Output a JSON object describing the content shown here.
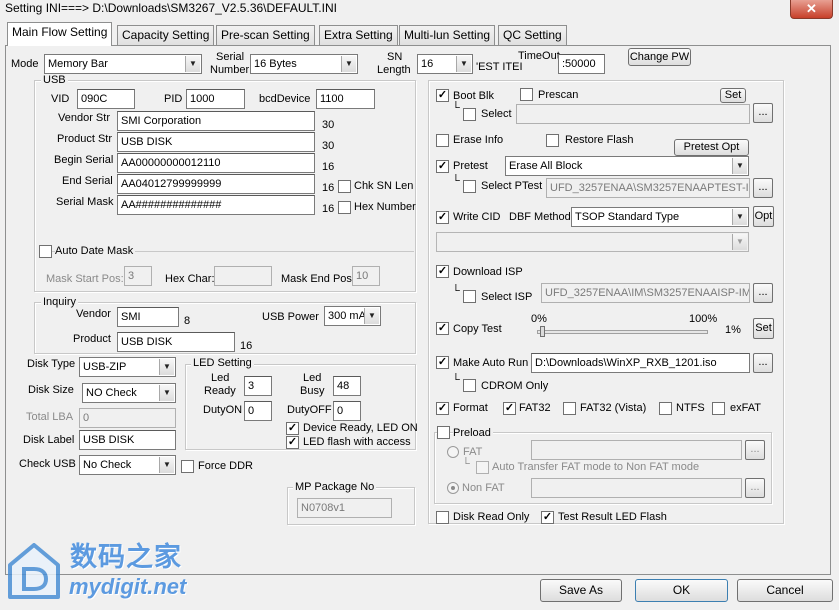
{
  "window": {
    "title": "Setting  INI===> D:\\Downloads\\SM3267_V2.5.36\\DEFAULT.INI",
    "close_icon": "close-icon"
  },
  "tabs": [
    "Main Flow Setting",
    "Capacity Setting",
    "Pre-scan Setting",
    "Extra Setting",
    "Multi-lun Setting",
    "QC Setting"
  ],
  "top": {
    "mode_label": "Mode",
    "mode_value": "Memory Bar",
    "serial_label1": "Serial",
    "serial_label2": "Number",
    "serial_value": "16 Bytes",
    "sn_label1": "SN",
    "sn_label2": "Length",
    "sn_value": "16",
    "test_item_label": "'EST ITEI",
    "timeout_label": "TimeOut",
    "timeout_value": ":50000",
    "change_pw": "Change PW"
  },
  "usb": {
    "title": "USB",
    "vid_label": "VID",
    "vid": "090C",
    "pid_label": "PID",
    "pid": "1000",
    "bcd_label": "bcdDevice",
    "bcd": "1100",
    "vendor_label": "Vendor Str",
    "vendor": "SMI Corporation",
    "vendor_len": "30",
    "product_label": "Product Str",
    "product": "USB DISK",
    "product_len": "30",
    "begin_label": "Begin Serial",
    "begin": "AA00000000012110",
    "begin_len": "16",
    "end_label": "End Serial",
    "end": "AA04012799999999",
    "end_len": "16",
    "mask_label": "Serial Mask",
    "mask": "AA##############",
    "mask_len": "16",
    "chk_sn_len": "Chk SN Len",
    "hex_number": "Hex Number",
    "auto_date_mask": "Auto Date Mask",
    "mask_start_label": "Mask Start Pos:",
    "mask_start": "3",
    "hex_char_label": "Hex Char:",
    "hex_char": "",
    "mask_end_label": "Mask End Pos:",
    "mask_end": "10"
  },
  "inquiry": {
    "title": "Inquiry",
    "vendor_label": "Vendor",
    "vendor": "SMI",
    "vendor_len": "8",
    "usb_power_label": "USB Power",
    "usb_power": "300 mA",
    "product_label": "Product",
    "product": "USB DISK",
    "product_len": "16"
  },
  "disk": {
    "type_label": "Disk Type",
    "type": "USB-ZIP",
    "size_label": "Disk Size",
    "size": "NO Check",
    "lba_label": "Total LBA",
    "lba": "0",
    "label_label": "Disk Label",
    "label": "USB DISK",
    "check_usb_label": "Check USB",
    "check_usb": "No Check",
    "force_ddr": "Force DDR"
  },
  "led": {
    "title": "LED Setting",
    "ready_label1": "Led",
    "ready_label2": "Ready",
    "ready": "3",
    "busy_label1": "Led",
    "busy_label2": "Busy",
    "busy": "48",
    "dutyon_label": "DutyON",
    "dutyon": "0",
    "dutyoff_label": "DutyOFF",
    "dutyoff": "0",
    "device_ready": "Device Ready, LED ON",
    "flash_access": "LED flash with access"
  },
  "mp": {
    "title": "MP Package No",
    "value": "N0708v1"
  },
  "right": {
    "boot_blk": "Boot Blk",
    "prescan": "Prescan",
    "set": "Set",
    "select": "Select",
    "erase_info": "Erase Info",
    "restore_flash": "Restore Flash",
    "pretest_opt": "Pretest Opt",
    "pretest": "Pretest",
    "pretest_mode": "Erase All Block",
    "select_ptest": "Select PTest",
    "ptest_path": "UFD_3257ENAA\\SM3257ENAAPTEST-IM_",
    "write_cid": "Write CID",
    "dbf_label": "DBF Method",
    "dbf_value": "TSOP Standard Type",
    "opt": "Opt",
    "download_isp": "Download ISP",
    "select_isp": "Select ISP",
    "isp_path": "UFD_3257ENAA\\IM\\SM3257ENAAISP-IM_",
    "copy_test": "Copy Test",
    "pct0": "0%",
    "pct100": "100%",
    "pct_value": "1%",
    "copy_set": "Set",
    "copy_progress": 0.01,
    "make_auto_run": "Make Auto Run",
    "autorun_path": "D:\\Downloads\\WinXP_RXB_1201.iso",
    "cdrom_only": "CDROM Only",
    "format": "Format",
    "fat32": "FAT32",
    "fat32_vista": "FAT32 (Vista)",
    "ntfs": "NTFS",
    "exfat": "exFAT",
    "preload": "Preload",
    "fat": "FAT",
    "auto_transfer": "Auto Transfer FAT mode to Non FAT mode",
    "non_fat": "Non FAT",
    "disk_read_only": "Disk Read Only",
    "test_result_led": "Test Result LED Flash",
    "browse": "...",
    "check": "✓"
  },
  "footer": {
    "save_as": "Save  As",
    "ok": "OK",
    "cancel": "Cancel"
  },
  "watermark": {
    "cn": "数码之家",
    "en": "mydigit.net"
  }
}
